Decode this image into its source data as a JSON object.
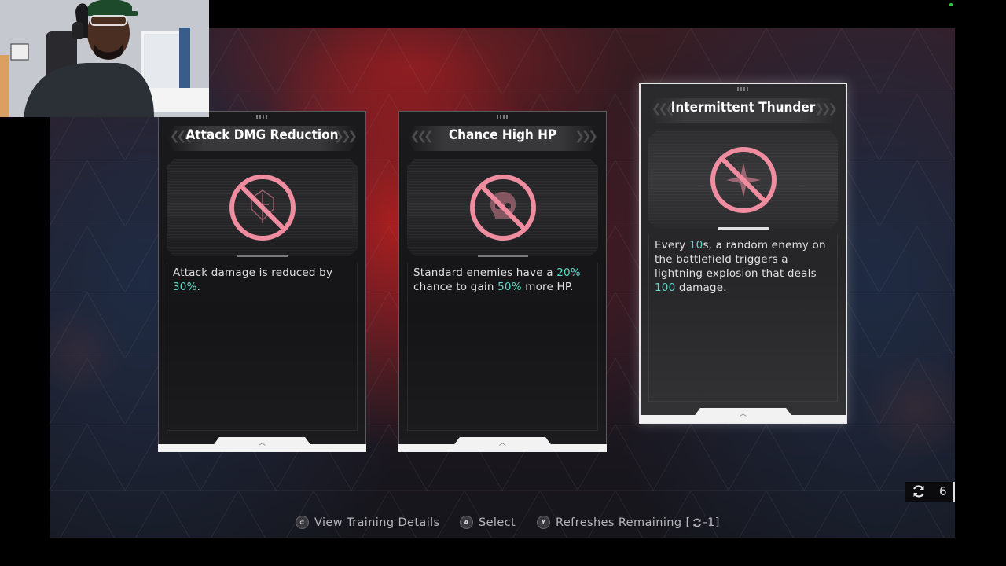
{
  "cards": [
    {
      "title": "Attack DMG Reduction",
      "icon": "crossed-out-sword-shield-icon",
      "desc_parts": [
        "Attack damage is reduced by ",
        "30%",
        "."
      ],
      "selected": false
    },
    {
      "title": "Chance High HP",
      "icon": "crossed-out-skull-icon",
      "desc_parts": [
        "Standard enemies have a ",
        "20%",
        " chance to gain ",
        "50%",
        " more HP."
      ],
      "selected": false
    },
    {
      "title": "Intermittent Thunder",
      "icon": "crossed-out-star-compass-icon",
      "desc_parts": [
        "Every ",
        "10",
        "s, a random enemy on the battlefield triggers a lightning explosion that deals ",
        "100",
        " damage."
      ],
      "selected": true
    }
  ],
  "refresh": {
    "icon": "refresh-icon",
    "count": "6"
  },
  "hints": {
    "view_details": {
      "button": "⊂",
      "label": "View Training Details"
    },
    "select": {
      "button": "A",
      "label": "Select"
    },
    "refreshes": {
      "button": "Y",
      "label": "Refreshes Remaining [",
      "suffix": "-1]"
    }
  },
  "colors": {
    "highlight": "#5fd6c6",
    "icon_pink": "#f08ca0",
    "card_selected_border": "#e6e6e6"
  },
  "webcam": {
    "description_icon": "streamer-webcam-overlay"
  }
}
